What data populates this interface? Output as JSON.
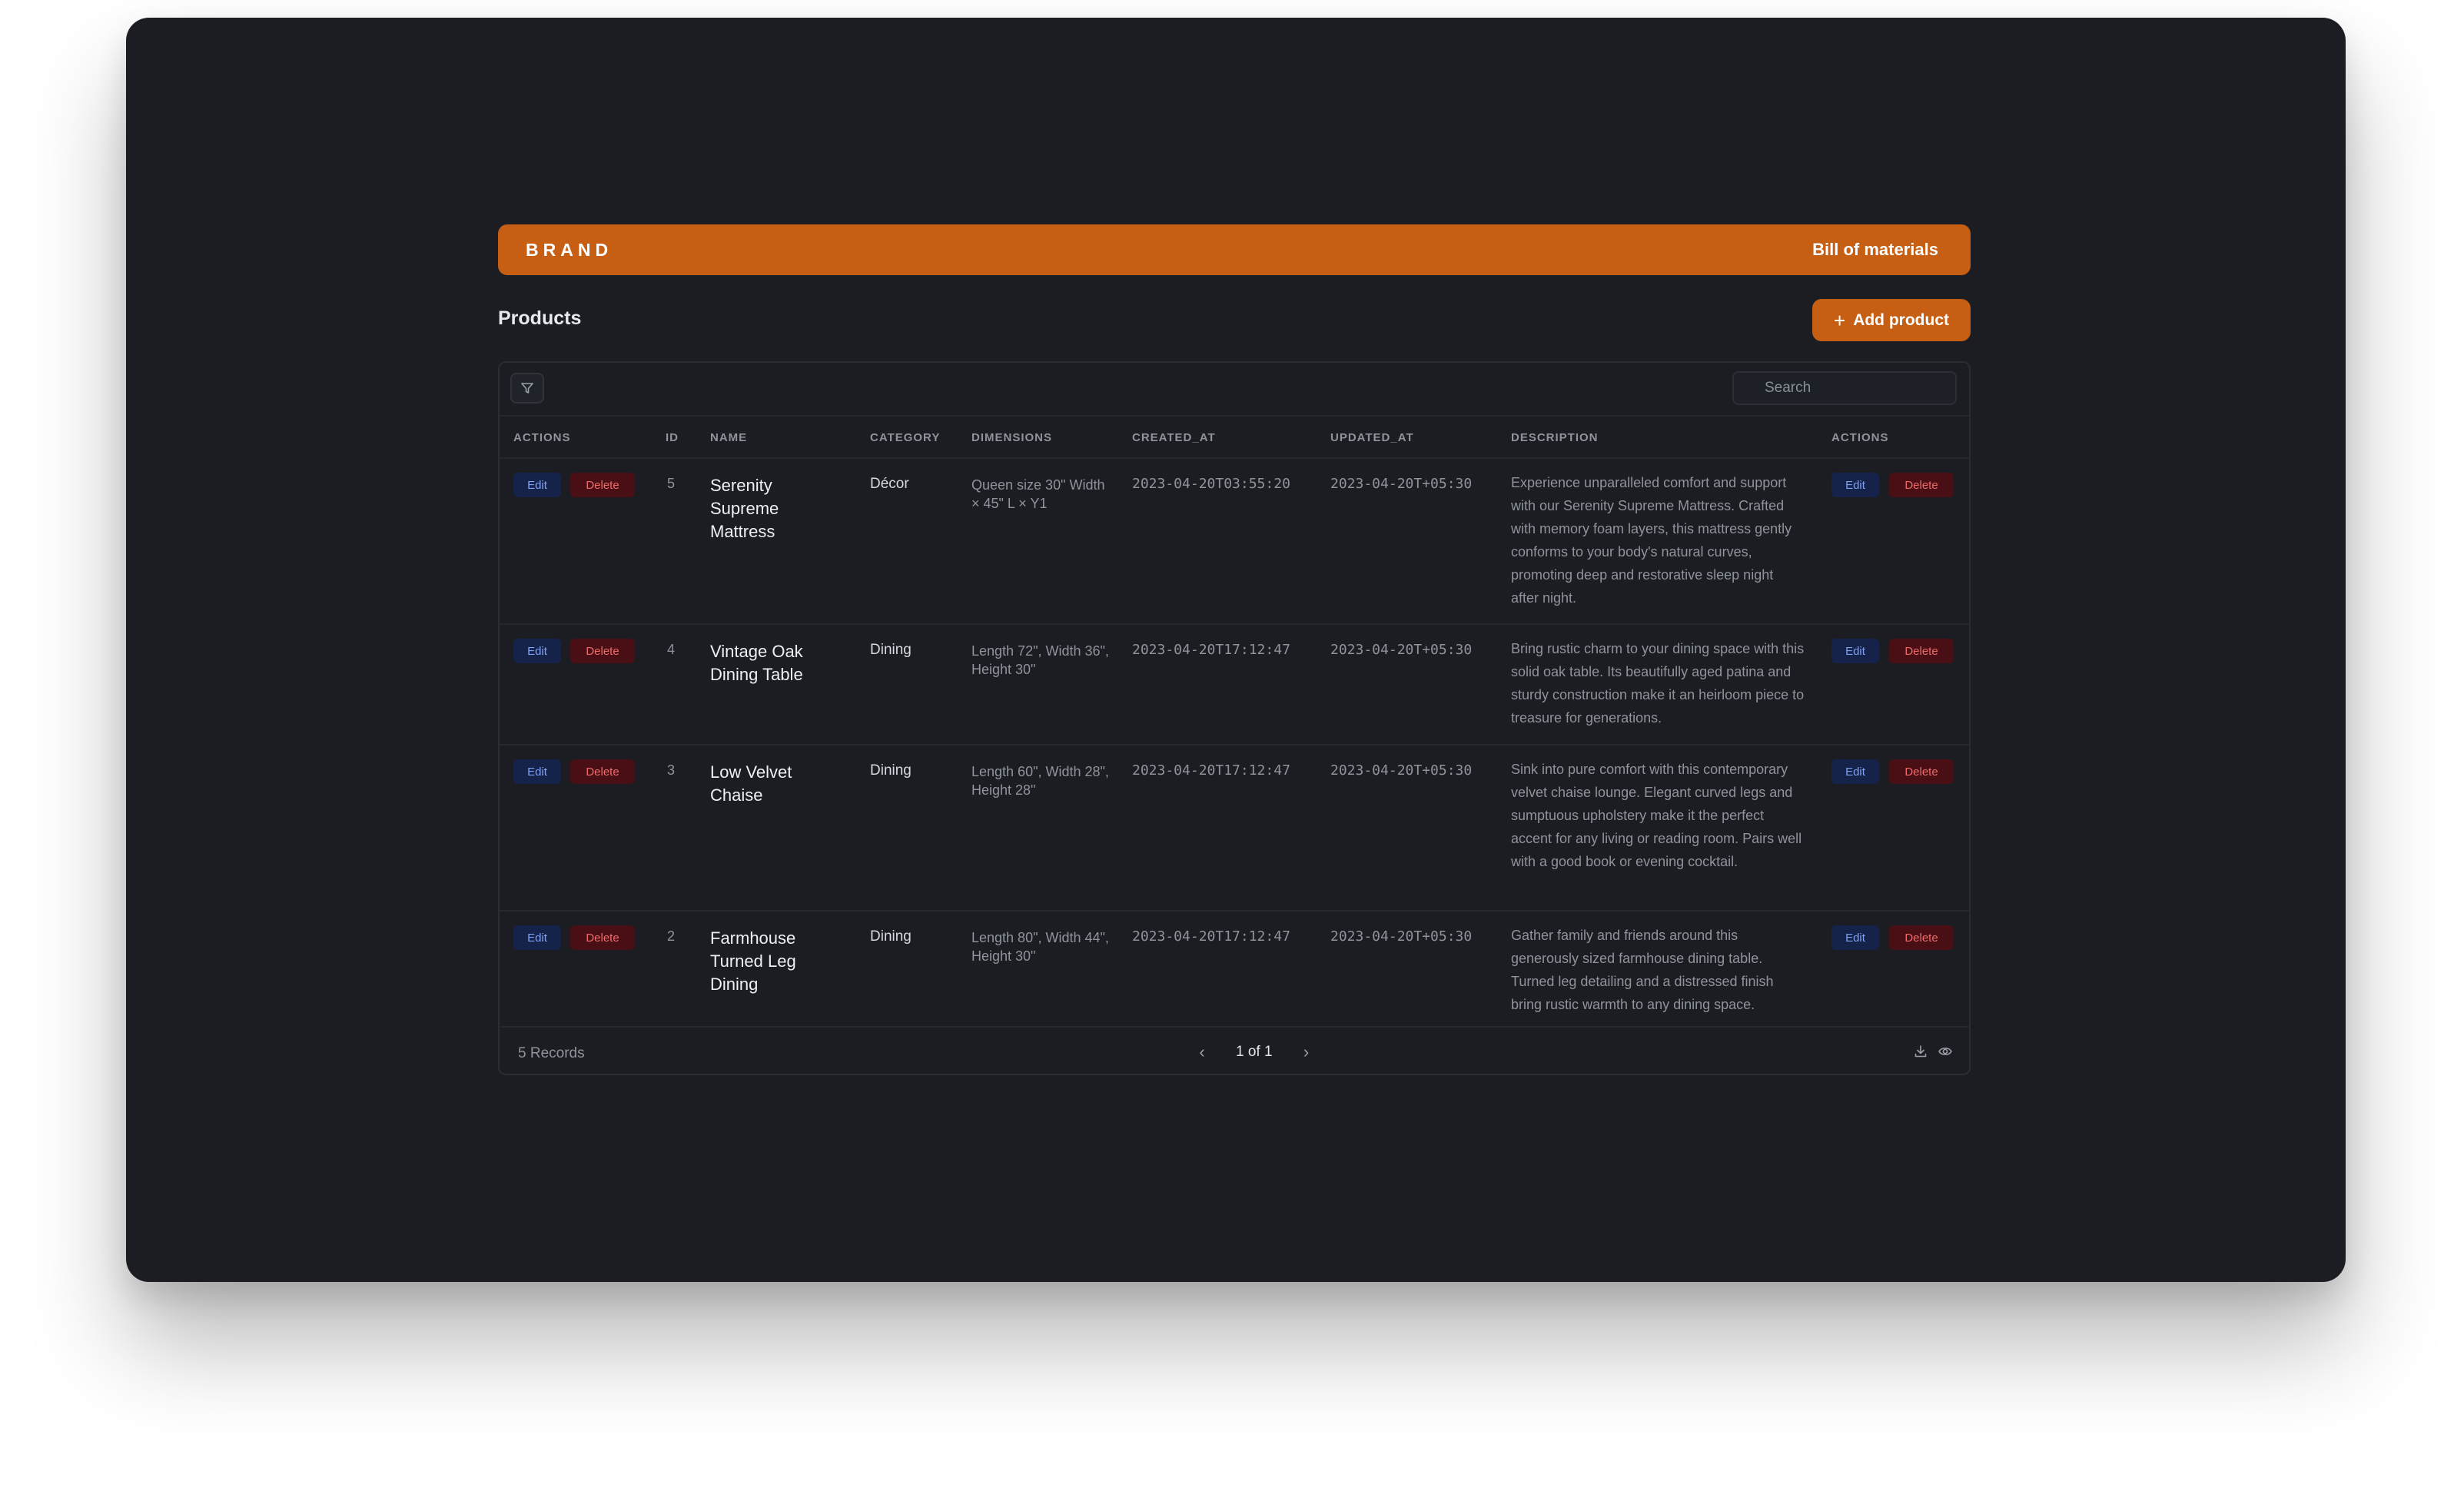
{
  "header": {
    "brand": "BRAND",
    "nav_link": "Bill of materials"
  },
  "page": {
    "title": "Products",
    "add_button": "Add product"
  },
  "toolbar": {
    "search_placeholder": "Search",
    "filter_icon": "filter-icon"
  },
  "table": {
    "columns": [
      "ACTIONS",
      "ID",
      "NAME",
      "CATEGORY",
      "DIMENSIONS",
      "CREATED_AT",
      "UPDATED_AT",
      "DESCRIPTION",
      "ACTIONS"
    ],
    "action_labels": {
      "edit": "Edit",
      "delete": "Delete"
    },
    "rows": [
      {
        "id": "5",
        "name": "Serenity Supreme Mattress",
        "category": "Décor",
        "dimensions": "Queen size 30\" Width × 45\" L × Y1",
        "created_at": "2023-04-20T03:55:20",
        "updated_at": "2023-04-20T+05:30",
        "description": "Experience unparalleled comfort and support with our Serenity Supreme Mattress. Crafted with memory foam layers, this mattress gently conforms to your body's natural curves, promoting deep and restorative sleep night after night."
      },
      {
        "id": "4",
        "name": "Vintage Oak Dining Table",
        "category": "Dining",
        "dimensions": "Length 72\", Width 36\", Height 30\"",
        "created_at": "2023-04-20T17:12:47",
        "updated_at": "2023-04-20T+05:30",
        "description": "Bring rustic charm to your dining space with this solid oak table. Its beautifully aged patina and sturdy construction make it an heirloom piece to treasure for generations."
      },
      {
        "id": "3",
        "name": "Low Velvet Chaise",
        "category": "Dining",
        "dimensions": "Length 60\", Width 28\", Height 28\"",
        "created_at": "2023-04-20T17:12:47",
        "updated_at": "2023-04-20T+05:30",
        "description": "Sink into pure comfort with this contemporary velvet chaise lounge. Elegant curved legs and sumptuous upholstery make it the perfect accent for any living or reading room. Pairs well with a good book or evening cocktail."
      },
      {
        "id": "2",
        "name": "Farmhouse Turned Leg Dining",
        "category": "Dining",
        "dimensions": "Length 80\", Width 44\", Height 30\"",
        "created_at": "2023-04-20T17:12:47",
        "updated_at": "2023-04-20T+05:30",
        "description": "Gather family and friends around this generously sized farmhouse dining table. Turned leg detailing and a distressed finish bring rustic warmth to any dining space."
      }
    ]
  },
  "footer": {
    "records": "5 Records",
    "pagination": "1 of 1",
    "icons": [
      "chevron-left-icon",
      "chevron-right-icon",
      "download-icon",
      "eye-icon"
    ]
  },
  "colors": {
    "accent": "#c65f13",
    "background": "#1b1d22",
    "edit": "#7fa1f3",
    "delete": "#ef6b6b"
  }
}
